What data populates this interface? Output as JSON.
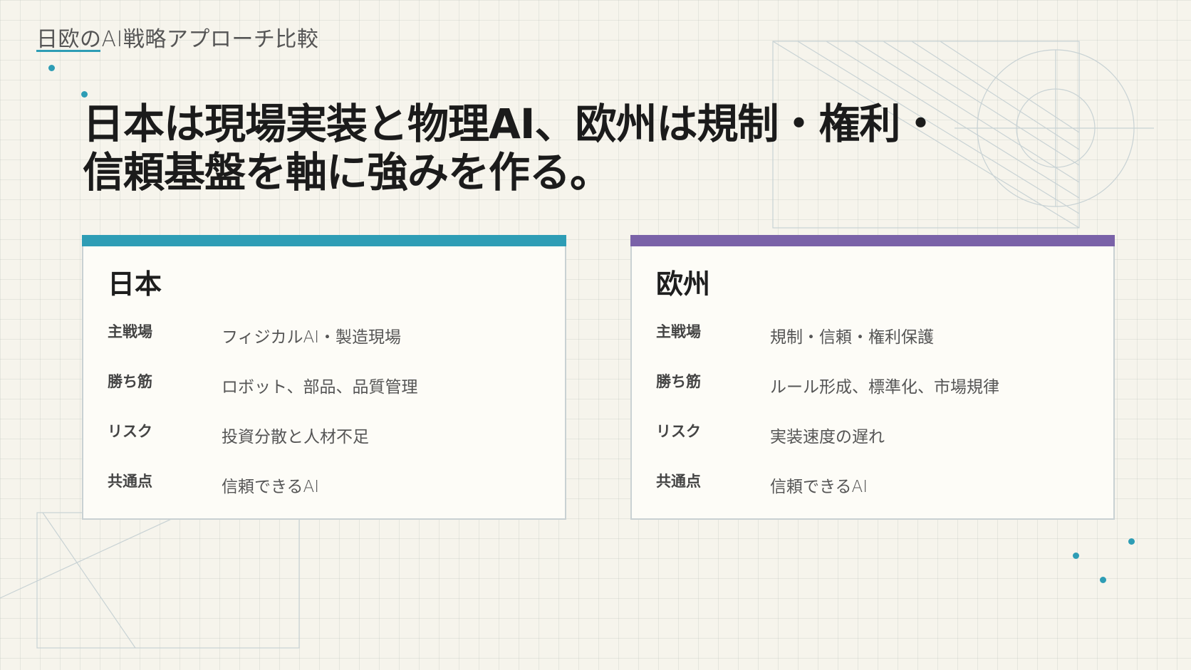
{
  "eyebrow": "日欧のAI戦略アプローチ比較",
  "headline": {
    "line1": "日本は現場実装と物理AI、欧州は規制・権利・",
    "line2": "信頼基盤を軸に強みを作る。"
  },
  "colors": {
    "accent_teal": "#2e9db5",
    "accent_purple": "#7a62a8",
    "background": "#f6f4ec"
  },
  "cards": [
    {
      "title": "日本",
      "accent": "#2e9db5",
      "rows": [
        {
          "label": "主戦場",
          "value": "フィジカルAI・製造現場"
        },
        {
          "label": "勝ち筋",
          "value": "ロボット、部品、品質管理"
        },
        {
          "label": "リスク",
          "value": "投資分散と人材不足"
        },
        {
          "label": "共通点",
          "value": "信頼できるAI"
        }
      ]
    },
    {
      "title": "欧州",
      "accent": "#7a62a8",
      "rows": [
        {
          "label": "主戦場",
          "value": "規制・信頼・権利保護"
        },
        {
          "label": "勝ち筋",
          "value": "ルール形成、標準化、市場規律"
        },
        {
          "label": "リスク",
          "value": "実装速度の遅れ"
        },
        {
          "label": "共通点",
          "value": "信頼できるAI"
        }
      ]
    }
  ]
}
